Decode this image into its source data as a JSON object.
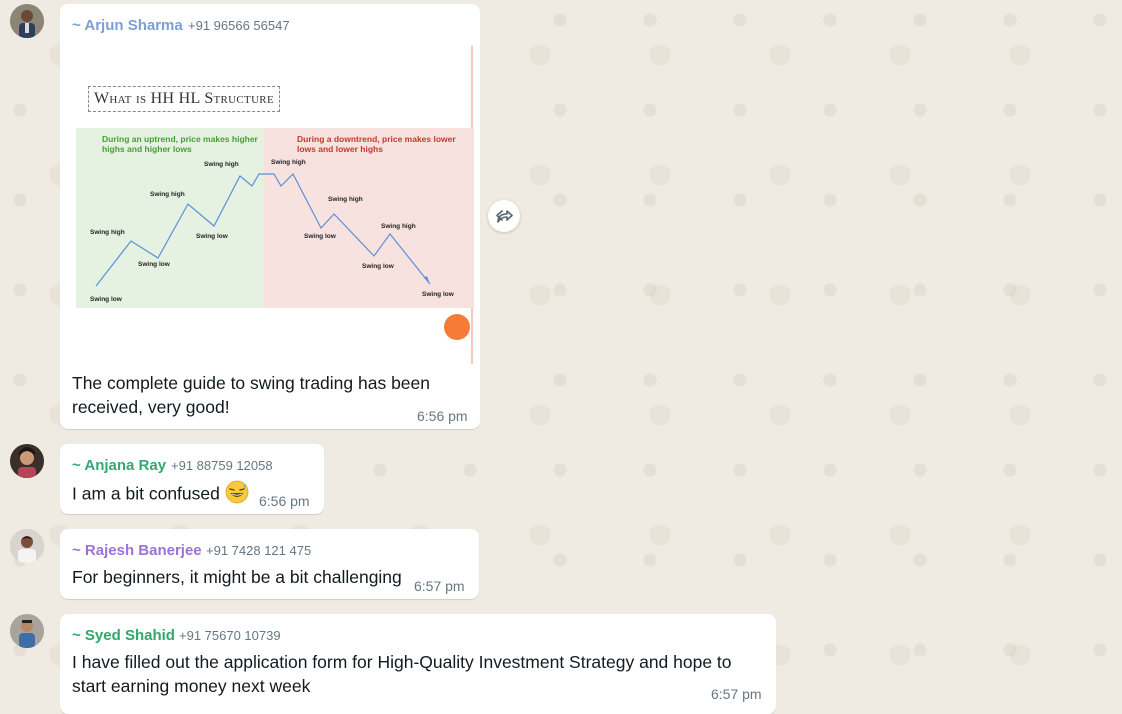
{
  "messages": [
    {
      "sender": "~ Arjun Sharma",
      "sender_color": "#7b9fd6",
      "phone": "+91 96566 56547",
      "text": "The complete guide to swing trading has been received, very good!",
      "time": "6:56 pm",
      "image": {
        "title": "What is HH HL Structure",
        "uptrend_caption": "During an uptrend, price makes higher highs and higher lows",
        "downtrend_caption": "During a downtrend, price makes lower lows and lower highs",
        "labels": {
          "swing_high": "Swing high",
          "swing_low": "Swing low"
        }
      }
    },
    {
      "sender": "~ Anjana Ray",
      "sender_color": "#34a873",
      "phone": "+91 88759 12058",
      "text": "I am a bit confused",
      "emoji": "grinning-sweat-emoji",
      "time": "6:56 pm"
    },
    {
      "sender": "~ Rajesh Banerjee",
      "sender_color": "#9b72d8",
      "phone": "+91 7428 121 475",
      "text": "For beginners, it might be a bit challenging",
      "time": "6:57 pm"
    },
    {
      "sender": "~ Syed Shahid",
      "sender_color": "#2fa86a",
      "phone": "+91 75670 10739",
      "text": "I have filled out the application form for High-Quality Investment Strategy and hope to start earning money next week",
      "time": "6:57 pm"
    }
  ],
  "forward_icon": "forward-icon",
  "colors": {
    "background": "#efeae2",
    "bubble": "#ffffff",
    "meta": "#667781"
  }
}
